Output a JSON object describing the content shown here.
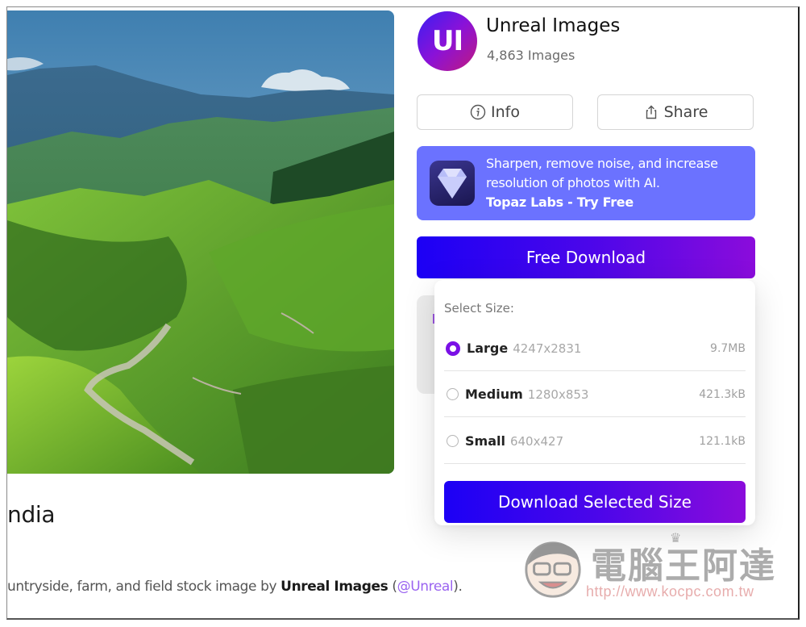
{
  "photo": {
    "alt": "Green terraced hills and mountains in India countryside"
  },
  "image_title": "ndia",
  "description": {
    "prefix": "untryside, farm, and field stock image by ",
    "author": "Unreal Images",
    "open_paren": " (",
    "handle": "@Unreal",
    "close": ")."
  },
  "brand": {
    "initials": "UI",
    "name": "Unreal Images",
    "count": "4,863 Images"
  },
  "actions": {
    "info_label": "Info",
    "share_label": "Share",
    "info_icon": "info-circle-icon",
    "share_icon": "share-upload-icon"
  },
  "promo": {
    "icon": "diamond-icon",
    "text": "Sharpen, remove noise, and increase resolution of photos with AI.",
    "cta": "Topaz Labs - Try Free"
  },
  "free_download_label": "Free Download",
  "size_menu": {
    "label": "Select Size:",
    "options": [
      {
        "name": "Large",
        "dimensions": "4247x2831",
        "file_size": "9.7MB",
        "selected": true
      },
      {
        "name": "Medium",
        "dimensions": "1280x853",
        "file_size": "421.3kB",
        "selected": false
      },
      {
        "name": "Small",
        "dimensions": "640x427",
        "file_size": "121.1kB",
        "selected": false
      }
    ],
    "download_label": "Download Selected Size"
  },
  "colors": {
    "accent_gradient_start": "#1c00f5",
    "accent_gradient_end": "#8b0cdb",
    "promo_bg": "#6b72ff",
    "radio_selected": "#7a10e6",
    "handle_link": "#9a63f0"
  },
  "watermark": {
    "title": "電腦王阿達",
    "url": "http://www.kocpc.com.tw"
  }
}
